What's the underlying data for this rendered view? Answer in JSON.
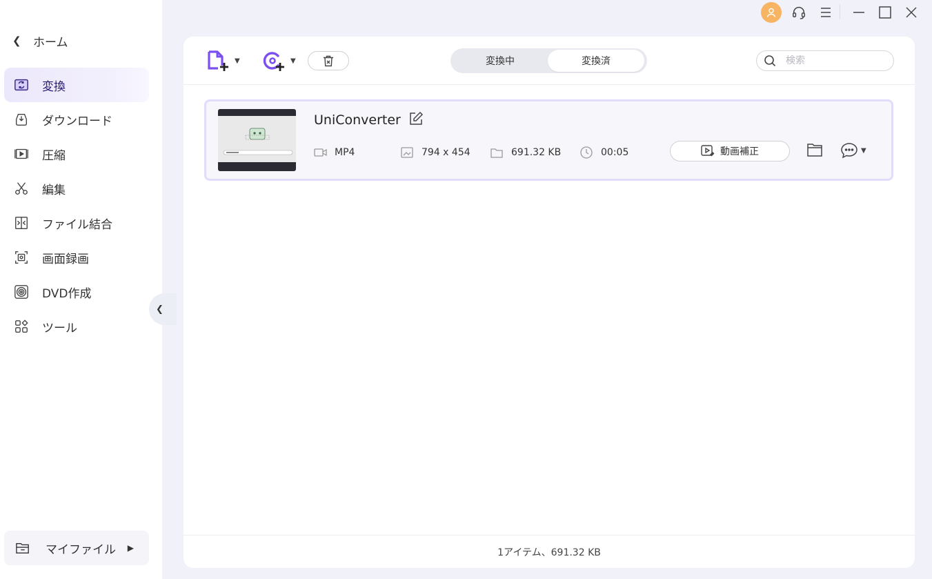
{
  "sidebar": {
    "home_label": "ホーム",
    "items": [
      {
        "label": "変換",
        "icon": "convert-icon",
        "active": true
      },
      {
        "label": "ダウンロード",
        "icon": "download-icon"
      },
      {
        "label": "圧縮",
        "icon": "compress-icon"
      },
      {
        "label": "編集",
        "icon": "scissors-icon"
      },
      {
        "label": "ファイル結合",
        "icon": "merge-icon"
      },
      {
        "label": "画面録画",
        "icon": "screen-record-icon"
      },
      {
        "label": "DVD作成",
        "icon": "dvd-icon"
      },
      {
        "label": "ツール",
        "icon": "tools-icon"
      }
    ],
    "myfiles_label": "マイファイル"
  },
  "toolbar": {
    "tabs": [
      {
        "label": "変換中"
      },
      {
        "label": "変換済"
      }
    ],
    "search_placeholder": "検索"
  },
  "file": {
    "name": "UniConverter",
    "format": "MP4",
    "resolution": "794 x 454",
    "size": "691.32 KB",
    "duration": "00:05",
    "enhance_label": "動画補正"
  },
  "footer": {
    "summary": "1アイテム、691.32 KB"
  },
  "colors": {
    "accent": "#7b4ff0",
    "avatar": "#f7b463",
    "active_bg": "#ece8fc"
  }
}
